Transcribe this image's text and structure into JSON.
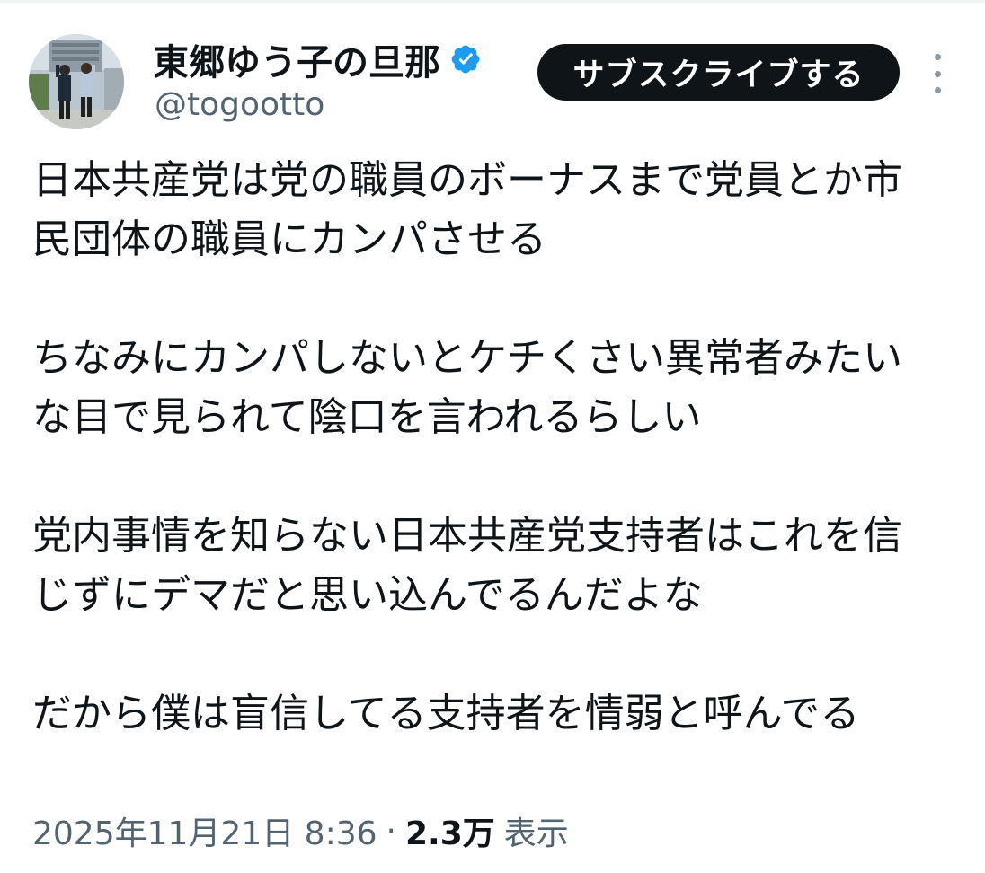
{
  "tweet": {
    "author": {
      "display_name": "東郷ゆう子の旦那",
      "handle": "@togootto",
      "verified_icon": "verified-badge-icon",
      "avatar": "profile-photo"
    },
    "subscribe_label": "サブスクライブする",
    "more_icon": "more-options-icon",
    "paragraphs": [
      "日本共産党は党の職員のボーナスまで党員とか市民団体の職員にカンパさせる",
      "ちなみにカンパしないとケチくさい異常者みたいな目で見られて陰口を言われるらしい",
      "党内事情を知らない日本共産党支持者はこれを信じずにデマだと思い込んでるんだよな",
      "だから僕は盲信してる支持者を情弱と呼んでる"
    ],
    "meta": {
      "timestamp": "2025年11月21日 8:36",
      "separator": "·",
      "views_count": "2.3万",
      "views_label": "表示"
    }
  },
  "colors": {
    "text_primary": "#0f1419",
    "text_secondary": "#536471",
    "verified_blue": "#1d9bf0",
    "button_bg": "#0f1419"
  }
}
